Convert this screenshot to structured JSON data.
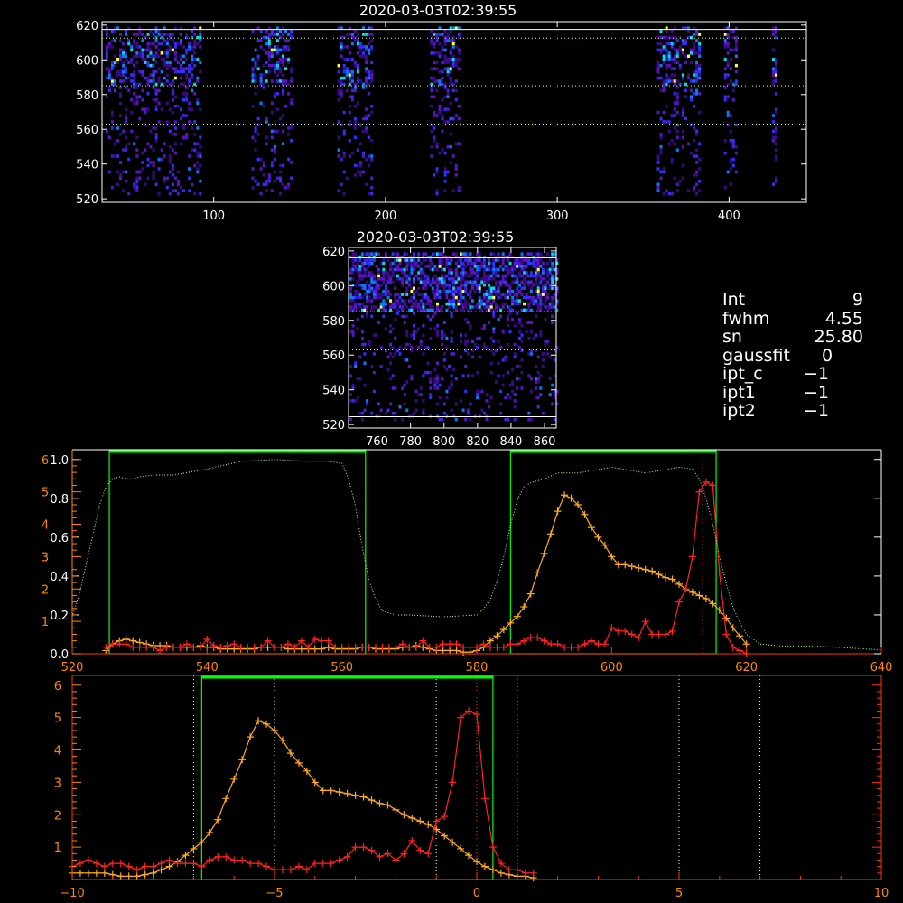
{
  "colors": {
    "background": "#000000",
    "axes": "#ffffff",
    "axes_lower": "#ff3300",
    "orange_axis": "#ff8800",
    "green": "#00ff00",
    "dotted_green": "#b8ff7a",
    "red_series": "#ff2222",
    "orange_series": "#ffaa22"
  },
  "stats": [
    {
      "key": "Int",
      "value": "9"
    },
    {
      "key": "fwhm",
      "value": "4.55"
    },
    {
      "key": "sn",
      "value": "25.80"
    },
    {
      "key": "gaussfit",
      "value": "0"
    },
    {
      "key": "ipt_c",
      "value": "−1"
    },
    {
      "key": "ipt1",
      "value": "−1"
    },
    {
      "key": "ipt2",
      "value": "−1"
    }
  ],
  "chart_data": [
    {
      "type": "heatmap",
      "title": "2020-03-03T02:39:55",
      "xlim": [
        35,
        445
      ],
      "ylim": [
        518,
        622
      ],
      "xticks": [
        "100",
        "200",
        "300",
        "400"
      ],
      "xtick_values": [
        100,
        200,
        300,
        400
      ],
      "yticks": [
        "520",
        "540",
        "560",
        "580",
        "600",
        "620"
      ],
      "ytick_values": [
        520,
        540,
        560,
        580,
        600,
        620
      ],
      "hlines_solid": [
        524.5,
        617.5
      ],
      "hlines_dotted": [
        563,
        585,
        612.5,
        615.5
      ],
      "bands": [
        [
          37,
          92
        ],
        [
          122,
          145
        ],
        [
          172,
          192
        ],
        [
          226,
          243
        ],
        [
          358,
          383
        ],
        [
          397,
          404
        ],
        [
          425,
          428
        ]
      ]
    },
    {
      "type": "heatmap",
      "title": "2020-03-03T02:39:55",
      "xlim": [
        743,
        867
      ],
      "ylim": [
        518,
        622
      ],
      "xticks": [
        "760",
        "780",
        "800",
        "820",
        "840",
        "860"
      ],
      "xtick_values": [
        760,
        780,
        800,
        820,
        840,
        860
      ],
      "yticks": [
        "520",
        "540",
        "560",
        "580",
        "600",
        "620"
      ],
      "ytick_values": [
        520,
        540,
        560,
        580,
        600,
        620
      ],
      "hlines_solid": [
        524.5,
        616
      ],
      "hlines_dotted": [
        563,
        585
      ]
    },
    {
      "type": "line",
      "xlim": [
        520,
        640
      ],
      "xticks": [
        "520",
        "540",
        "560",
        "580",
        "600",
        "620",
        "640"
      ],
      "xtick_values": [
        520,
        540,
        560,
        580,
        600,
        620,
        640
      ],
      "yticks_left": [
        "0.0",
        "0.2",
        "0.4",
        "0.6",
        "0.8",
        "1.0"
      ],
      "ylim": [
        0,
        1.05
      ],
      "yticks_orange": [
        "1",
        "2",
        "3",
        "4",
        "5",
        "6"
      ],
      "ylim_orange": [
        0,
        6.3
      ],
      "green_boxes": [
        [
          525.5,
          563.5
        ],
        [
          585,
          615.5
        ]
      ],
      "vlines_dotted": [
        613.5
      ],
      "dotted_curve": {
        "x": [
          520,
          521,
          522,
          523,
          524,
          525,
          526,
          527,
          528,
          529,
          530,
          532,
          535,
          540,
          545,
          550,
          555,
          558,
          560,
          561,
          562,
          563,
          564,
          565,
          566,
          568,
          570,
          575,
          580,
          581,
          582,
          583,
          584,
          585,
          586,
          587,
          588,
          590,
          592,
          595,
          600,
          605,
          610,
          612,
          613,
          614,
          615,
          616,
          617,
          618,
          619,
          620,
          622,
          625,
          630,
          640
        ],
        "y": [
          0.19,
          0.3,
          0.45,
          0.6,
          0.76,
          0.86,
          0.9,
          0.91,
          0.9,
          0.9,
          0.91,
          0.92,
          0.92,
          0.95,
          0.99,
          1.0,
          0.99,
          0.99,
          0.98,
          0.9,
          0.76,
          0.55,
          0.38,
          0.28,
          0.22,
          0.2,
          0.2,
          0.19,
          0.2,
          0.23,
          0.28,
          0.37,
          0.5,
          0.66,
          0.79,
          0.86,
          0.88,
          0.9,
          0.93,
          0.93,
          0.96,
          0.93,
          0.96,
          0.95,
          0.9,
          0.8,
          0.67,
          0.5,
          0.36,
          0.24,
          0.16,
          0.1,
          0.05,
          0.04,
          0.04,
          0.02
        ]
      },
      "red_series": {
        "x": [
          525,
          526,
          527,
          528,
          529,
          530,
          531,
          532,
          533,
          534,
          535,
          536,
          537,
          538,
          539,
          540,
          541,
          542,
          543,
          544,
          545,
          546,
          547,
          548,
          549,
          550,
          551,
          552,
          553,
          554,
          555,
          556,
          557,
          558,
          559,
          560,
          561,
          562,
          563,
          564,
          565,
          566,
          567,
          568,
          569,
          570,
          571,
          572,
          573,
          574,
          575,
          576,
          577,
          578,
          579,
          580,
          581,
          582,
          583,
          584,
          585,
          586,
          587,
          588,
          589,
          590,
          591,
          592,
          593,
          594,
          595,
          596,
          597,
          598,
          599,
          600,
          601,
          602,
          603,
          604,
          605,
          606,
          607,
          608,
          609,
          610,
          611,
          612,
          613,
          614,
          615,
          616,
          617,
          618,
          619,
          620
        ],
        "y": [
          0.2,
          0.3,
          0.3,
          0.3,
          0.2,
          0.2,
          0.2,
          0.2,
          0.1,
          0.2,
          0.2,
          0.2,
          0.3,
          0.2,
          0.2,
          0.45,
          0.25,
          0.2,
          0.25,
          0.3,
          0.2,
          0.2,
          0.2,
          0.2,
          0.4,
          0.2,
          0.2,
          0.3,
          0.2,
          0.4,
          0.2,
          0.45,
          0.4,
          0.4,
          0.2,
          0.2,
          0.2,
          0.2,
          0.2,
          0.2,
          0.2,
          0.2,
          0.2,
          0.2,
          0.3,
          0.2,
          0.2,
          0.4,
          0.2,
          0.2,
          0.3,
          0.3,
          0.3,
          0.2,
          0.2,
          0.2,
          0.3,
          0.2,
          0.2,
          0.2,
          0.3,
          0.3,
          0.4,
          0.5,
          0.5,
          0.4,
          0.3,
          0.3,
          0.2,
          0.2,
          0.2,
          0.3,
          0.4,
          0.3,
          0.3,
          0.8,
          0.7,
          0.7,
          0.6,
          0.5,
          1.0,
          0.6,
          0.6,
          0.6,
          0.7,
          1.6,
          2.0,
          3.0,
          5.0,
          5.3,
          5.2,
          2.5,
          0.6,
          0.2,
          0.1,
          0.0
        ]
      },
      "orange_series": {
        "x": [
          525,
          526,
          527,
          528,
          529,
          530,
          531,
          532,
          533,
          534,
          535,
          536,
          537,
          538,
          539,
          540,
          541,
          542,
          543,
          544,
          545,
          546,
          547,
          548,
          549,
          550,
          551,
          552,
          553,
          554,
          555,
          556,
          557,
          558,
          559,
          560,
          561,
          562,
          563,
          564,
          565,
          566,
          567,
          568,
          569,
          570,
          571,
          572,
          573,
          574,
          575,
          576,
          577,
          578,
          579,
          580,
          581,
          582,
          583,
          584,
          585,
          586,
          587,
          588,
          589,
          590,
          591,
          592,
          593,
          594,
          595,
          596,
          597,
          598,
          599,
          600,
          601,
          602,
          603,
          604,
          605,
          606,
          607,
          608,
          609,
          610,
          611,
          612,
          613,
          614,
          615,
          616,
          617,
          618,
          619,
          620
        ],
        "y": [
          0.1,
          0.3,
          0.4,
          0.45,
          0.4,
          0.35,
          0.3,
          0.25,
          0.25,
          0.25,
          0.2,
          0.2,
          0.2,
          0.2,
          0.25,
          0.2,
          0.2,
          0.15,
          0.15,
          0.15,
          0.15,
          0.15,
          0.15,
          0.2,
          0.2,
          0.2,
          0.2,
          0.15,
          0.15,
          0.15,
          0.15,
          0.15,
          0.15,
          0.2,
          0.15,
          0.15,
          0.15,
          0.15,
          0.2,
          0.2,
          0.15,
          0.15,
          0.15,
          0.15,
          0.2,
          0.2,
          0.25,
          0.2,
          0.15,
          0.1,
          0.1,
          0.1,
          0.1,
          0.05,
          0.05,
          0.1,
          0.2,
          0.4,
          0.55,
          0.75,
          0.95,
          1.15,
          1.45,
          1.85,
          2.5,
          3.1,
          3.7,
          4.4,
          4.9,
          4.8,
          4.6,
          4.3,
          3.9,
          3.6,
          3.35,
          3.0,
          2.75,
          2.75,
          2.7,
          2.65,
          2.6,
          2.55,
          2.45,
          2.35,
          2.3,
          2.15,
          2.0,
          1.9,
          1.8,
          1.7,
          1.55,
          1.35,
          1.1,
          0.8,
          0.55,
          0.3
        ]
      }
    },
    {
      "type": "line",
      "xlim": [
        -10,
        10
      ],
      "xticks": [
        "−10",
        "−5",
        "0",
        "5",
        "10"
      ],
      "xtick_values": [
        -10,
        -5,
        0,
        5,
        10
      ],
      "yticks_orange": [
        "1",
        "2",
        "3",
        "4",
        "5",
        "6"
      ],
      "ylim_orange": [
        0,
        6.3
      ],
      "green_boxes": [
        [
          -6.8,
          0.4
        ]
      ],
      "vlines_dotted": [
        -7,
        -5,
        -1,
        0,
        1,
        5,
        7
      ],
      "red_series": {
        "x": [
          -10,
          -9.8,
          -9.6,
          -9.4,
          -9.2,
          -9.0,
          -8.8,
          -8.6,
          -8.4,
          -8.2,
          -8.0,
          -7.8,
          -7.6,
          -7.4,
          -7.2,
          -7.0,
          -6.8,
          -6.6,
          -6.4,
          -6.2,
          -6.0,
          -5.8,
          -5.6,
          -5.4,
          -5.2,
          -5.0,
          -4.8,
          -4.6,
          -4.4,
          -4.2,
          -4.0,
          -3.8,
          -3.6,
          -3.4,
          -3.2,
          -3.0,
          -2.8,
          -2.6,
          -2.4,
          -2.2,
          -2.0,
          -1.8,
          -1.6,
          -1.4,
          -1.2,
          -1.0,
          -0.8,
          -0.6,
          -0.4,
          -0.2,
          0.0,
          0.2,
          0.4,
          0.6,
          0.8,
          1.0,
          1.2,
          1.4
        ],
        "y": [
          0.4,
          0.5,
          0.6,
          0.5,
          0.4,
          0.5,
          0.5,
          0.4,
          0.3,
          0.4,
          0.4,
          0.5,
          0.6,
          0.5,
          0.5,
          0.5,
          0.4,
          0.6,
          0.7,
          0.7,
          0.6,
          0.6,
          0.5,
          0.5,
          0.4,
          0.3,
          0.3,
          0.3,
          0.4,
          0.3,
          0.5,
          0.5,
          0.5,
          0.6,
          0.7,
          1.0,
          1.0,
          0.9,
          0.7,
          0.8,
          0.6,
          0.8,
          1.2,
          0.9,
          0.8,
          1.8,
          1.95,
          3.0,
          5.0,
          5.2,
          5.1,
          2.5,
          1.0,
          0.5,
          0.3,
          0.3,
          0.2,
          0.2
        ]
      },
      "orange_series": {
        "x": [
          -10,
          -9.8,
          -9.6,
          -9.4,
          -9.2,
          -9.0,
          -8.8,
          -8.6,
          -8.4,
          -8.2,
          -8.0,
          -7.8,
          -7.6,
          -7.4,
          -7.2,
          -7.0,
          -6.8,
          -6.6,
          -6.4,
          -6.2,
          -6.0,
          -5.8,
          -5.6,
          -5.4,
          -5.2,
          -5.0,
          -4.8,
          -4.6,
          -4.4,
          -4.2,
          -4.0,
          -3.8,
          -3.6,
          -3.4,
          -3.2,
          -3.0,
          -2.8,
          -2.6,
          -2.4,
          -2.2,
          -2.0,
          -1.8,
          -1.6,
          -1.4,
          -1.2,
          -1.0,
          -0.8,
          -0.6,
          -0.4,
          -0.2,
          0.0,
          0.2,
          0.4,
          0.6,
          0.8,
          1.0,
          1.2,
          1.4
        ],
        "y": [
          0.2,
          0.2,
          0.2,
          0.2,
          0.2,
          0.15,
          0.1,
          0.1,
          0.1,
          0.15,
          0.2,
          0.3,
          0.4,
          0.55,
          0.75,
          0.95,
          1.15,
          1.45,
          1.85,
          2.5,
          3.1,
          3.7,
          4.4,
          4.9,
          4.8,
          4.6,
          4.3,
          3.9,
          3.6,
          3.35,
          3.0,
          2.75,
          2.75,
          2.7,
          2.65,
          2.6,
          2.55,
          2.45,
          2.35,
          2.3,
          2.15,
          2.0,
          1.9,
          1.8,
          1.7,
          1.55,
          1.35,
          1.15,
          0.95,
          0.75,
          0.55,
          0.4,
          0.3,
          0.2,
          0.15,
          0.1,
          0.1,
          0.05
        ]
      }
    }
  ]
}
